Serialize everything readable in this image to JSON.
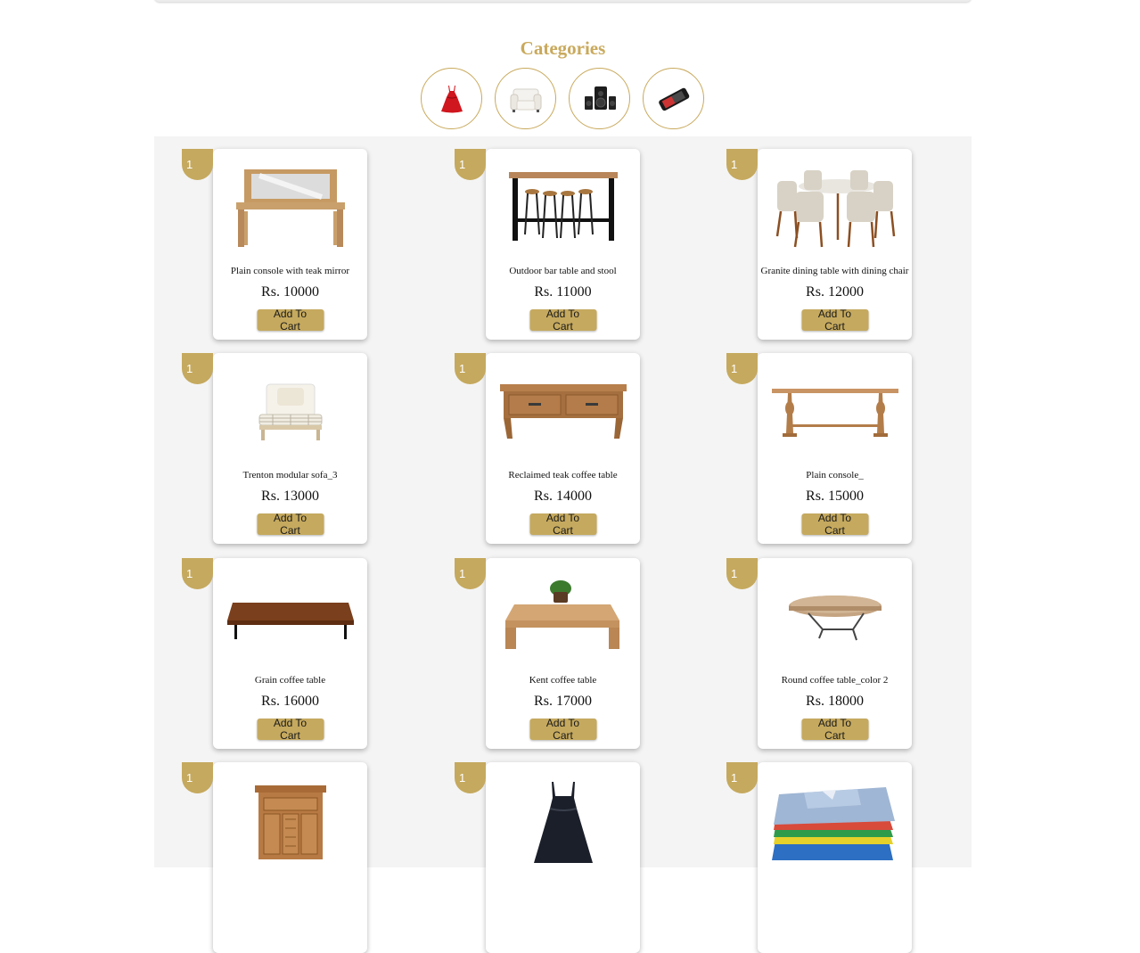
{
  "categories": {
    "title": "Categories",
    "items": [
      {
        "icon": "dress-icon"
      },
      {
        "icon": "armchair-icon"
      },
      {
        "icon": "speaker-icon"
      },
      {
        "icon": "phone-icon"
      }
    ]
  },
  "accent_color": "#c5a95e",
  "products": [
    {
      "badge": "1",
      "name": "Plain console with teak mirror",
      "price": "Rs. 10000",
      "button": "Add To Cart",
      "image": "console-mirror"
    },
    {
      "badge": "1",
      "name": "Outdoor bar table and stool",
      "price": "Rs. 11000",
      "button": "Add To Cart",
      "image": "bar-table"
    },
    {
      "badge": "1",
      "name": "Granite dining table with dining chair",
      "price": "Rs. 12000",
      "button": "Add To Cart",
      "image": "dining-set"
    },
    {
      "badge": "1",
      "name": "Trenton modular sofa_3",
      "price": "Rs. 13000",
      "button": "Add To Cart",
      "image": "sofa"
    },
    {
      "badge": "1",
      "name": "Reclaimed teak coffee table",
      "price": "Rs. 14000",
      "button": "Add To Cart",
      "image": "teak-table"
    },
    {
      "badge": "1",
      "name": "Plain console_",
      "price": "Rs. 15000",
      "button": "Add To Cart",
      "image": "plain-console"
    },
    {
      "badge": "1",
      "name": "Grain coffee table",
      "price": "Rs. 16000",
      "button": "Add To Cart",
      "image": "grain-table"
    },
    {
      "badge": "1",
      "name": "Kent coffee table",
      "price": "Rs. 17000",
      "button": "Add To Cart",
      "image": "kent-table"
    },
    {
      "badge": "1",
      "name": "Round coffee table_color 2",
      "price": "Rs. 18000",
      "button": "Add To Cart",
      "image": "round-table"
    },
    {
      "badge": "1",
      "name": "",
      "price": "",
      "button": "",
      "image": "cabinet"
    },
    {
      "badge": "1",
      "name": "",
      "price": "",
      "button": "",
      "image": "black-dress"
    },
    {
      "badge": "1",
      "name": "",
      "price": "",
      "button": "",
      "image": "shirts-stack"
    }
  ]
}
